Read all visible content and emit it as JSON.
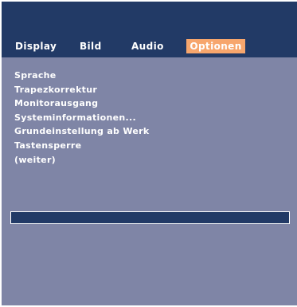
{
  "tabs": [
    {
      "label": "Display"
    },
    {
      "label": "Bild"
    },
    {
      "label": "Audio"
    },
    {
      "label": "Optionen",
      "active": true
    }
  ],
  "menu": {
    "items": [
      {
        "label": "Sprache"
      },
      {
        "label": "Trapezkorrektur"
      },
      {
        "label": "Monitorausgang"
      },
      {
        "label": "Systeminformationen..."
      },
      {
        "label": "Grundeinstellung ab Werk"
      },
      {
        "label": "Tastensperre"
      },
      {
        "label": "(weiter)"
      }
    ]
  },
  "colors": {
    "header_background": "#223a66",
    "body_background": "#7f85a6",
    "active_tab": "#f7a66d",
    "text": "#ffffff"
  }
}
